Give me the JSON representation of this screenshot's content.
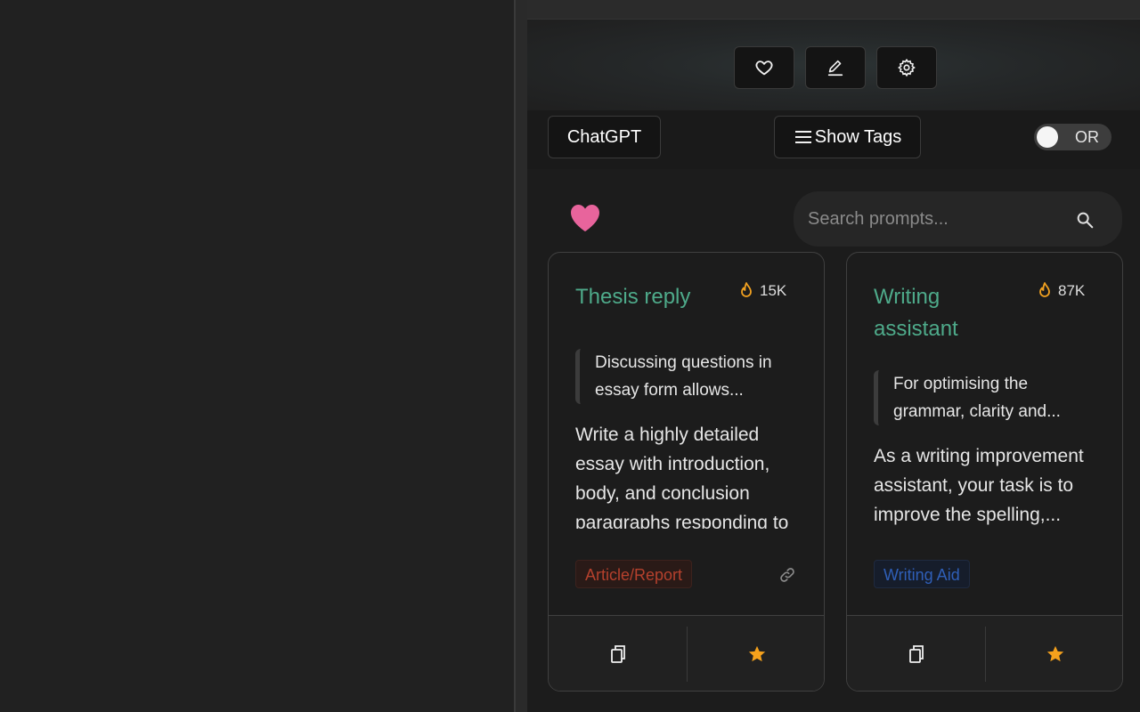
{
  "toolbar": {
    "favorites_icon": "heart-outline-icon",
    "edit_icon": "pencil-icon",
    "settings_icon": "gear-icon",
    "model_label": "ChatGPT",
    "tags_label": "Show Tags",
    "toggle_label": "OR"
  },
  "search": {
    "placeholder": "Search prompts..."
  },
  "colors": {
    "accent_green": "#4eaa8a",
    "heart_pink": "#e8649c",
    "flame_orange": "#f0a020",
    "star_orange": "#f5a11c"
  },
  "cards": [
    {
      "title": "Thesis reply",
      "views": "15K",
      "quote": "Discussing questions in essay form allows...",
      "body": "Write a highly detailed essay with introduction, body, and conclusion paragraphs responding to",
      "tag": "Article/Report",
      "tag_color": "#b5412d"
    },
    {
      "title": "Writing assistant",
      "views": "87K",
      "quote": "For optimising the grammar, clarity and...",
      "body": "As a writing improvement assistant, your task is to improve the spelling,...",
      "tag": "Writing Aid",
      "tag_color": "#2f5fb8"
    }
  ]
}
